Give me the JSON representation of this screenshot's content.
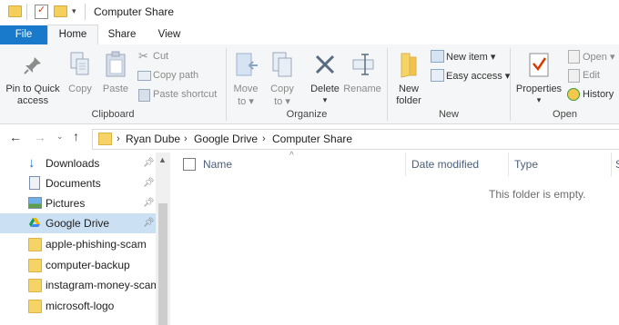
{
  "window": {
    "title": "Computer Share"
  },
  "tabs": [
    "File",
    "Home",
    "Share",
    "View"
  ],
  "ribbon": {
    "clipboard": {
      "label": "Clipboard",
      "pin_line1": "Pin to Quick",
      "pin_line2": "access",
      "copy": "Copy",
      "paste": "Paste",
      "cut": "Cut",
      "copy_path": "Copy path",
      "paste_shortcut": "Paste shortcut"
    },
    "organize": {
      "label": "Organize",
      "move_to_line1": "Move",
      "move_to_line2": "to",
      "copy_to_line1": "Copy",
      "copy_to_line2": "to",
      "delete": "Delete",
      "rename": "Rename"
    },
    "new": {
      "label": "New",
      "new_folder_line1": "New",
      "new_folder_line2": "folder",
      "new_item": "New item",
      "easy_access": "Easy access"
    },
    "open": {
      "label": "Open",
      "properties": "Properties",
      "open": "Open",
      "edit": "Edit",
      "history": "History"
    }
  },
  "address": {
    "breadcrumbs": [
      "Ryan Dube",
      "Google Drive",
      "Computer Share"
    ]
  },
  "nav_pane": {
    "items": [
      {
        "label": "Downloads",
        "icon": "download-icon",
        "pinned": true
      },
      {
        "label": "Documents",
        "icon": "documents-icon",
        "pinned": true
      },
      {
        "label": "Pictures",
        "icon": "pictures-icon",
        "pinned": true
      },
      {
        "label": "Google Drive",
        "icon": "google-drive-icon",
        "pinned": true,
        "selected": true
      },
      {
        "label": "apple-phishing-scam",
        "icon": "folder-icon"
      },
      {
        "label": "computer-backup",
        "icon": "folder-icon"
      },
      {
        "label": "instagram-money-scam",
        "icon": "folder-icon"
      },
      {
        "label": "microsoft-logo",
        "icon": "folder-icon"
      }
    ]
  },
  "content": {
    "columns": [
      "Name",
      "Date modified",
      "Type",
      "S"
    ],
    "empty_message": "This folder is empty."
  },
  "colors": {
    "accent": "#1979ca",
    "selection": "#cce0f3",
    "folder": "#f6d365"
  }
}
